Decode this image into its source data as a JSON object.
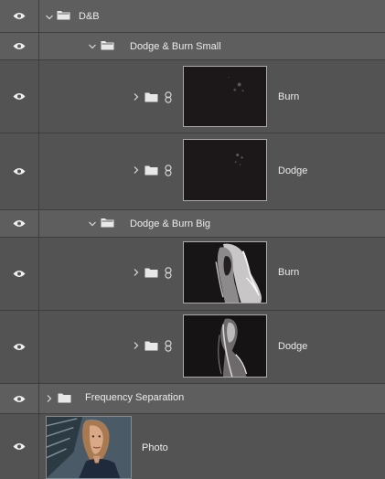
{
  "layers": {
    "db_group": {
      "name": "D&B"
    },
    "small_group": {
      "name": "Dodge & Burn Small"
    },
    "small_burn": {
      "name": "Burn"
    },
    "small_dodge": {
      "name": "Dodge"
    },
    "big_group": {
      "name": "Dodge & Burn Big"
    },
    "big_burn": {
      "name": "Burn"
    },
    "big_dodge": {
      "name": "Dodge"
    },
    "freq_group": {
      "name": "Frequency Separation"
    },
    "photo": {
      "name": "Photo"
    }
  },
  "icons": {
    "eye": "eye-icon",
    "chevron": "chevron-icon",
    "folder": "folder-icon",
    "link": "chain-link-icon"
  },
  "colors": {
    "panel_bg": "#535353",
    "selected_group_bg": "#5e5e5e",
    "divider": "#3e3e3e",
    "text": "#ececec",
    "thumb_dark": "#1b1819"
  }
}
